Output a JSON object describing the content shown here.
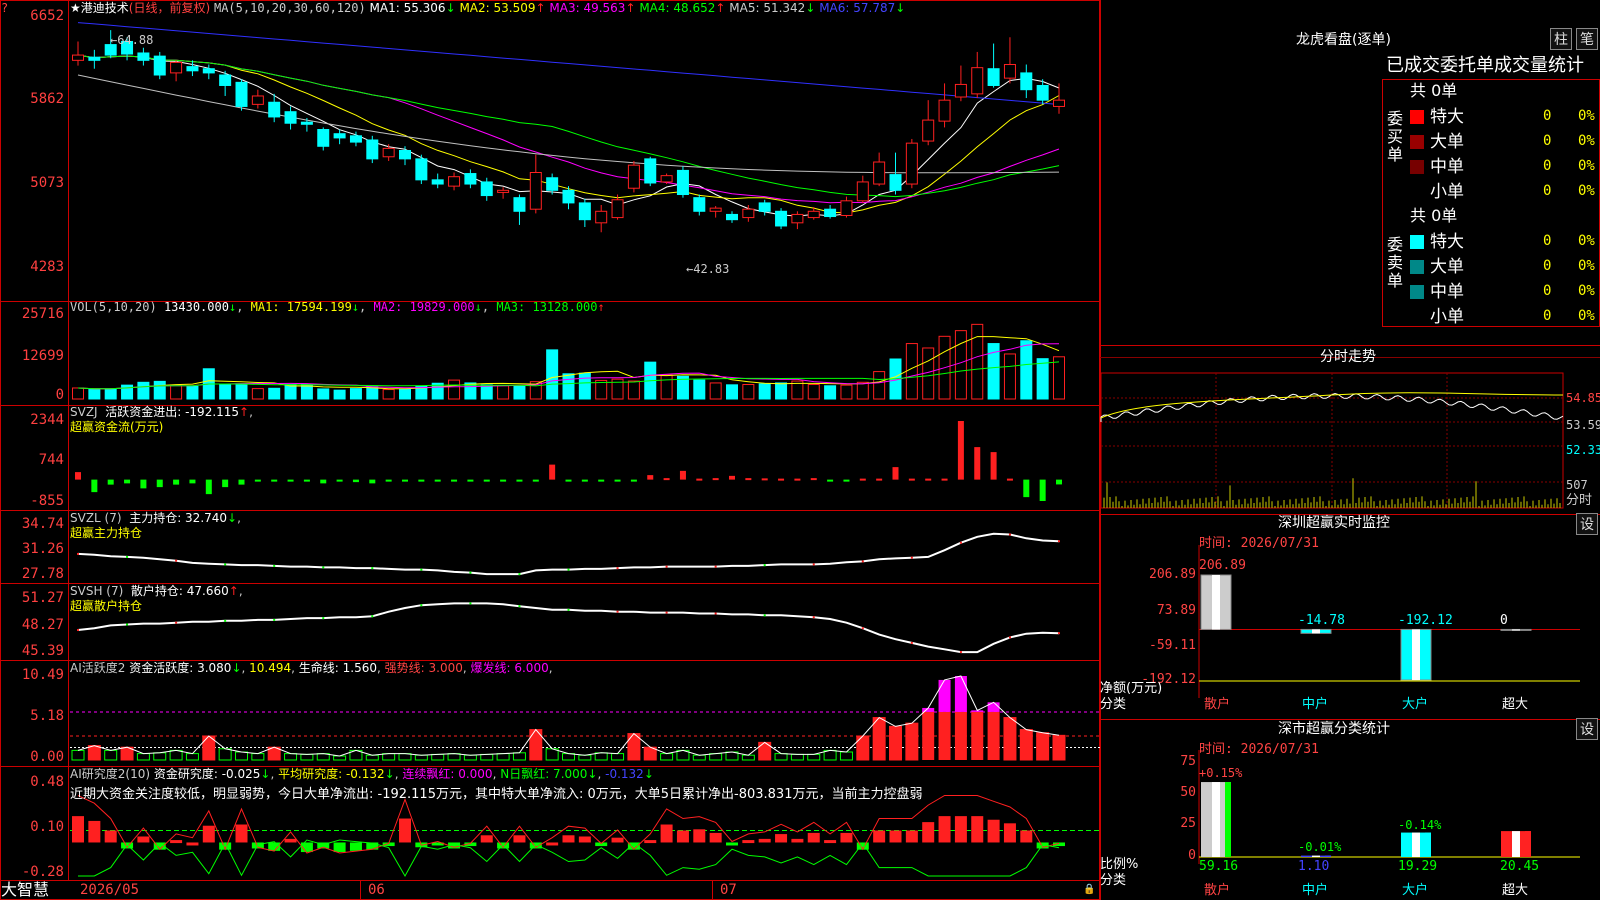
{
  "colors": {
    "up": "#ff2020",
    "down": "#00ffff",
    "bg": "#000000",
    "grid": "#c00000",
    "text": "#c0c0c0",
    "ma1": "#ffffff",
    "ma2": "#ffff00",
    "ma3": "#ff00ff",
    "ma4": "#00ff00",
    "ma5": "#c0c0c0",
    "ma6": "#3030ff",
    "yellow": "#ffff00",
    "green": "#00ff00",
    "magenta": "#ff00ff"
  },
  "header": {
    "stock": "★港迪技术",
    "period": "(日线，前复权)",
    "ma_params": "MA(5,10,20,30,60,120)",
    "ma_values": [
      {
        "label": "MA1: 55.306",
        "arrow": "↓"
      },
      {
        "label": "MA2: 53.509",
        "arrow": "↑"
      },
      {
        "label": "MA3: 49.563",
        "arrow": "↑"
      },
      {
        "label": "MA4: 48.652",
        "arrow": "↑"
      },
      {
        "label": "MA5: 51.342",
        "arrow": "↓"
      },
      {
        "label": "MA6: 57.787",
        "arrow": "↓"
      }
    ]
  },
  "price_axis": [
    "6652",
    "5862",
    "5073",
    "4283"
  ],
  "markers": {
    "high": "←64.88",
    "low": "←42.83"
  },
  "vol": {
    "title": "VOL(5,10,20)",
    "value": "13430.000",
    "arrow": "↓",
    "ma": [
      {
        "label": "MA1: 17594.199",
        "arrow": "↓"
      },
      {
        "label": "MA2: 19829.000",
        "arrow": "↓"
      },
      {
        "label": "MA3: 13128.000",
        "arrow": "↑"
      }
    ],
    "axis": [
      "25716",
      "12699",
      "0"
    ]
  },
  "svzj": {
    "title": "SVZJ",
    "label": "活跃资金进出: -192.115",
    "arrow": "↑",
    "sub": "超赢资金流(万元)",
    "axis": [
      "2344",
      "744",
      "-855"
    ]
  },
  "svzl": {
    "title": "SVZL (7)",
    "label": "主力持仓: 32.740",
    "arrow": "↓",
    "sub": "超赢主力持仓",
    "axis": [
      "34.74",
      "31.26",
      "27.78"
    ]
  },
  "svsh": {
    "title": "SVSH (7)",
    "label": "散户持仓: 47.660",
    "arrow": "↑",
    "sub": "超赢散户持仓",
    "axis": [
      "51.27",
      "48.27",
      "45.39"
    ]
  },
  "ai1": {
    "title": "AI活跃度2",
    "label": "资金活跃度: 3.080",
    "arrow": "↓",
    "v2": "10.494",
    "life": "生命线: 1.560",
    "strong": "强势线: 3.000",
    "burst": "爆发线: 6.000",
    "axis": [
      "10.49",
      "5.18",
      "0.00"
    ]
  },
  "ai2": {
    "title": "AI研究度2(10)",
    "label": "资金研究度: -0.025",
    "arrow": "↓",
    "avg": "平均研究度: -0.132",
    "avg_arrow": "↓",
    "cont": "连续飘红: 0.000",
    "nday": "N日飘红: 7.000",
    "nday_arrow": "↓",
    "last": "-0.132",
    "last_arrow": "↓",
    "commentary": "近期大资金关注度较低，明显弱势，今日大单净流出: -192.115万元，其中特大单净流入: 0万元，大单5日累计净出-803.831万元，当前主力控盘弱",
    "axis": [
      "0.48",
      "0.10",
      "-0.28"
    ]
  },
  "dates": [
    "2026/05",
    "06",
    "07"
  ],
  "brand": "大智慧",
  "dragon": {
    "title": "龙虎看盘(逐单)",
    "btn1": "柱",
    "btn2": "笔",
    "tabs": "已成交委托单成交量统计",
    "buy_label": "委买单",
    "sell_label": "委卖单",
    "buy_total": "共 0单",
    "sell_total": "共 0单",
    "rows": [
      {
        "name": "特大",
        "count": "0",
        "pct": "0%"
      },
      {
        "name": "大单",
        "count": "0",
        "pct": "0%"
      },
      {
        "name": "中单",
        "count": "0",
        "pct": "0%"
      },
      {
        "name": "小单",
        "count": "0",
        "pct": "0%"
      }
    ]
  },
  "intraday": {
    "title": "分时走势",
    "axis": [
      "54.85",
      "53.59",
      "52.33"
    ],
    "vol_label": "507",
    "unit": "分时"
  },
  "monitor": {
    "title": "深圳超赢实时监控",
    "set": "设",
    "time": "时间: 2026/07/31",
    "axis": [
      "206.89",
      "73.89",
      "-59.11",
      "-192.12"
    ],
    "values": [
      "206.89",
      "-14.78",
      "-192.12",
      "0"
    ],
    "categories": [
      "散户",
      "中户",
      "大户",
      "超大"
    ],
    "ylabel": "净额(万元)",
    "xlabel": "分类"
  },
  "classify": {
    "title": "深市超赢分类统计",
    "set": "设",
    "time": "时间: 2026/07/31",
    "axis": [
      "75",
      "50",
      "25",
      "0"
    ],
    "top": [
      "+0.15%",
      "-0.01%",
      "-0.14%",
      ""
    ],
    "bottom": [
      "59.16",
      "1.10",
      "19.29",
      "20.45"
    ],
    "categories": [
      "散户",
      "中户",
      "大户",
      "超大"
    ],
    "ylabel": "比例%",
    "xlabel": "分类"
  },
  "chart_data": [
    {
      "type": "candlestick",
      "title": "港迪技术(日线，前复权)",
      "ylim": [
        42.0,
        66.8
      ],
      "axis_ticks": [
        66.52,
        58.62,
        50.73,
        42.83
      ],
      "candles": [
        [
          62.0,
          62.5,
          63.8,
          61.5
        ],
        [
          62.3,
          62.0,
          63.0,
          61.2
        ],
        [
          63.5,
          62.5,
          64.88,
          62.2
        ],
        [
          63.8,
          62.6,
          64.2,
          62.0
        ],
        [
          62.7,
          62.0,
          63.2,
          61.5
        ],
        [
          62.4,
          60.6,
          62.8,
          60.2
        ],
        [
          60.8,
          61.8,
          62.0,
          60.0
        ],
        [
          61.4,
          61.0,
          62.0,
          60.5
        ],
        [
          61.2,
          60.8,
          61.6,
          60.2
        ],
        [
          60.6,
          59.6,
          61.0,
          58.6
        ],
        [
          59.9,
          57.6,
          60.2,
          57.2
        ],
        [
          57.8,
          58.6,
          59.2,
          57.4
        ],
        [
          58.0,
          56.6,
          58.8,
          56.1
        ],
        [
          57.1,
          56.0,
          57.6,
          55.4
        ],
        [
          56.1,
          55.9,
          56.5,
          55.2
        ],
        [
          55.4,
          53.8,
          55.6,
          53.4
        ],
        [
          55.0,
          54.6,
          55.4,
          54.0
        ],
        [
          54.8,
          54.2,
          55.2,
          53.8
        ],
        [
          54.4,
          52.6,
          54.8,
          52.2
        ],
        [
          52.8,
          53.6,
          54.0,
          52.4
        ],
        [
          53.4,
          52.6,
          53.8,
          52.0
        ],
        [
          52.6,
          50.6,
          53.0,
          50.2
        ],
        [
          50.6,
          50.2,
          51.2,
          49.8
        ],
        [
          50.0,
          50.9,
          51.3,
          49.6
        ],
        [
          51.2,
          50.2,
          51.6,
          49.8
        ],
        [
          50.4,
          49.1,
          50.8,
          48.6
        ],
        [
          49.4,
          49.6,
          49.9,
          48.8
        ],
        [
          48.9,
          47.6,
          49.2,
          46.3
        ],
        [
          47.8,
          51.3,
          53.0,
          47.4
        ],
        [
          50.8,
          49.6,
          51.2,
          49.2
        ],
        [
          49.6,
          48.4,
          50.0,
          47.8
        ],
        [
          48.4,
          46.8,
          48.8,
          46.1
        ],
        [
          46.5,
          47.6,
          48.2,
          45.6
        ],
        [
          47.0,
          48.7,
          49.2,
          46.8
        ],
        [
          49.8,
          52.0,
          52.4,
          49.4
        ],
        [
          52.6,
          50.3,
          52.8,
          50.0
        ],
        [
          50.4,
          51.0,
          51.2,
          50.2
        ],
        [
          51.5,
          49.2,
          51.9,
          48.9
        ],
        [
          48.9,
          47.6,
          49.2,
          47.2
        ],
        [
          47.6,
          47.9,
          48.1,
          47.0
        ],
        [
          47.3,
          46.8,
          47.6,
          46.5
        ],
        [
          47.0,
          47.8,
          48.2,
          46.6
        ],
        [
          48.4,
          47.6,
          48.7,
          47.2
        ],
        [
          47.6,
          46.2,
          47.9,
          45.9
        ],
        [
          46.5,
          47.3,
          47.6,
          45.9
        ],
        [
          47.0,
          47.6,
          48.0,
          46.8
        ],
        [
          47.8,
          47.1,
          48.2,
          46.9
        ],
        [
          47.2,
          48.6,
          49.0,
          47.0
        ],
        [
          48.6,
          50.4,
          51.0,
          48.4
        ],
        [
          50.2,
          52.3,
          53.2,
          50.0
        ],
        [
          51.1,
          49.6,
          53.2,
          49.2
        ],
        [
          50.2,
          54.1,
          54.5,
          49.8
        ],
        [
          54.3,
          56.3,
          58.2,
          53.9
        ],
        [
          56.2,
          58.2,
          59.8,
          55.6
        ],
        [
          58.5,
          59.7,
          61.5,
          58.1
        ],
        [
          58.8,
          61.3,
          62.8,
          58.4
        ],
        [
          61.2,
          59.6,
          63.6,
          59.4
        ],
        [
          60.3,
          61.6,
          64.2,
          59.8
        ],
        [
          60.8,
          59.2,
          61.6,
          58.4
        ],
        [
          59.6,
          58.2,
          60.2,
          57.8
        ],
        [
          57.6,
          58.2,
          59.8,
          56.9
        ]
      ]
    },
    {
      "type": "bar",
      "title": "VOL(5,10,20)",
      "ylim": [
        0,
        25716
      ],
      "values": [
        3500,
        3000,
        3200,
        4400,
        5300,
        5600,
        4400,
        4000,
        9600,
        4500,
        4800,
        3300,
        3400,
        4600,
        4700,
        3200,
        2800,
        3300,
        3900,
        3000,
        3200,
        4000,
        5000,
        6000,
        5100,
        4500,
        4200,
        4300,
        5500,
        15600,
        8000,
        8200,
        5900,
        6300,
        5700,
        11700,
        7600,
        7200,
        6000,
        5100,
        4500,
        4600,
        4800,
        5100,
        5700,
        4600,
        4200,
        4400,
        5300,
        8700,
        12700,
        17600,
        16200,
        19900,
        21700,
        23700,
        17600,
        14300,
        18500,
        12800,
        13400
      ]
    },
    {
      "type": "bar",
      "title": "SVZJ 活跃资金进出",
      "ylim": [
        -855,
        2344
      ],
      "values": [
        300,
        -500,
        -200,
        -150,
        -350,
        -300,
        -200,
        -150,
        -580,
        -300,
        -200,
        -40,
        -40,
        -50,
        -50,
        -150,
        -40,
        -100,
        -150,
        -50,
        -50,
        -40,
        -60,
        -50,
        -60,
        -50,
        -50,
        -50,
        -50,
        600,
        -40,
        -50,
        -50,
        -50,
        -40,
        180,
        60,
        350,
        40,
        60,
        150,
        60,
        50,
        40,
        40,
        60,
        -50,
        -50,
        40,
        40,
        500,
        40,
        40,
        40,
        2344,
        1300,
        1100,
        40,
        -700,
        -855,
        -192
      ]
    },
    {
      "type": "line",
      "title": "SVZL 主力持仓",
      "ylim": [
        27.78,
        34.74
      ],
      "values": [
        31.0,
        30.9,
        30.7,
        30.6,
        30.5,
        30.3,
        30.1,
        29.8,
        29.7,
        29.6,
        29.5,
        29.5,
        29.4,
        29.3,
        29.3,
        29.2,
        29.2,
        29.1,
        29.1,
        29.0,
        28.9,
        28.9,
        28.8,
        28.6,
        28.5,
        28.3,
        28.3,
        28.3,
        28.8,
        28.9,
        28.9,
        29.0,
        29.0,
        29.1,
        29.2,
        29.2,
        29.3,
        29.3,
        29.3,
        29.3,
        29.4,
        29.4,
        29.5,
        29.6,
        29.6,
        29.6,
        29.7,
        29.9,
        30.0,
        30.3,
        30.4,
        30.5,
        30.6,
        31.5,
        32.5,
        33.3,
        33.7,
        33.6,
        33.1,
        32.8,
        32.7
      ]
    },
    {
      "type": "line",
      "title": "SVSH 散户持仓",
      "ylim": [
        45.39,
        51.27
      ],
      "values": [
        48.0,
        48.2,
        48.5,
        48.6,
        48.7,
        48.7,
        48.8,
        48.9,
        48.9,
        49.0,
        49.0,
        49.1,
        49.1,
        49.2,
        49.3,
        49.3,
        49.4,
        49.4,
        49.5,
        50.0,
        50.4,
        50.7,
        50.8,
        50.9,
        50.9,
        50.9,
        50.8,
        50.6,
        50.4,
        50.2,
        50.2,
        50.1,
        50.1,
        50.0,
        50.0,
        49.9,
        49.9,
        49.9,
        49.8,
        49.8,
        49.7,
        49.7,
        49.6,
        49.6,
        49.5,
        49.4,
        49.2,
        48.8,
        48.2,
        47.5,
        47.0,
        46.6,
        46.2,
        45.9,
        45.6,
        45.6,
        46.5,
        47.2,
        47.6,
        47.7,
        47.66
      ]
    },
    {
      "type": "bar",
      "title": "AI活跃度2",
      "ylim": [
        0,
        10.49
      ],
      "values": [
        1.2,
        1.8,
        1.2,
        1.6,
        0.8,
        0.9,
        1.2,
        0.8,
        3.0,
        1.4,
        1.0,
        0.8,
        1.6,
        0.8,
        0.7,
        0.8,
        0.5,
        1.2,
        0.6,
        0.8,
        0.8,
        0.6,
        0.7,
        0.8,
        0.6,
        0.7,
        0.8,
        0.9,
        3.8,
        1.4,
        0.8,
        0.6,
        0.9,
        0.8,
        3.3,
        1.6,
        0.8,
        1.2,
        0.6,
        0.8,
        1.0,
        0.6,
        2.2,
        0.8,
        0.7,
        0.7,
        1.2,
        1.0,
        3.0,
        5.3,
        4.2,
        4.6,
        6.5,
        10.0,
        10.49,
        6.2,
        7.2,
        5.3,
        3.8,
        3.4,
        3.08
      ]
    },
    {
      "type": "bar",
      "title": "AI研究度2(10)",
      "ylim": [
        -0.28,
        0.48
      ],
      "values": [
        0.22,
        0.18,
        0.1,
        -0.05,
        0.05,
        -0.06,
        0.02,
        0.0,
        0.14,
        -0.06,
        0.15,
        -0.05,
        -0.07,
        0.03,
        -0.08,
        -0.05,
        -0.08,
        -0.07,
        -0.06,
        -0.03,
        0.2,
        -0.04,
        -0.02,
        -0.05,
        -0.03,
        0.06,
        -0.05,
        0.06,
        -0.05,
        0.0,
        0.06,
        0.05,
        -0.03,
        0.04,
        -0.06,
        0.02,
        0.15,
        0.1,
        0.11,
        0.08,
        -0.02,
        0.02,
        0.03,
        0.07,
        0.03,
        0.08,
        0.02,
        0.08,
        -0.06,
        0.1,
        0.1,
        0.1,
        0.17,
        0.22,
        0.22,
        0.22,
        0.19,
        0.16,
        0.1,
        -0.05,
        -0.03
      ]
    },
    {
      "type": "bar",
      "title": "深圳超赢实时监控",
      "categories": [
        "散户",
        "中户",
        "大户",
        "超大"
      ],
      "values": [
        206.89,
        -14.78,
        -192.12,
        0
      ],
      "ylim": [
        -192.12,
        206.89
      ],
      "ylabel": "净额(万元)",
      "xlabel": "分类"
    },
    {
      "type": "bar",
      "title": "深市超赢分类统计",
      "categories": [
        "散户",
        "中户",
        "大户",
        "超大"
      ],
      "values": [
        59.16,
        1.1,
        19.29,
        20.45
      ],
      "ylim": [
        0,
        75
      ],
      "ylabel": "比例%",
      "xlabel": "分类"
    }
  ]
}
